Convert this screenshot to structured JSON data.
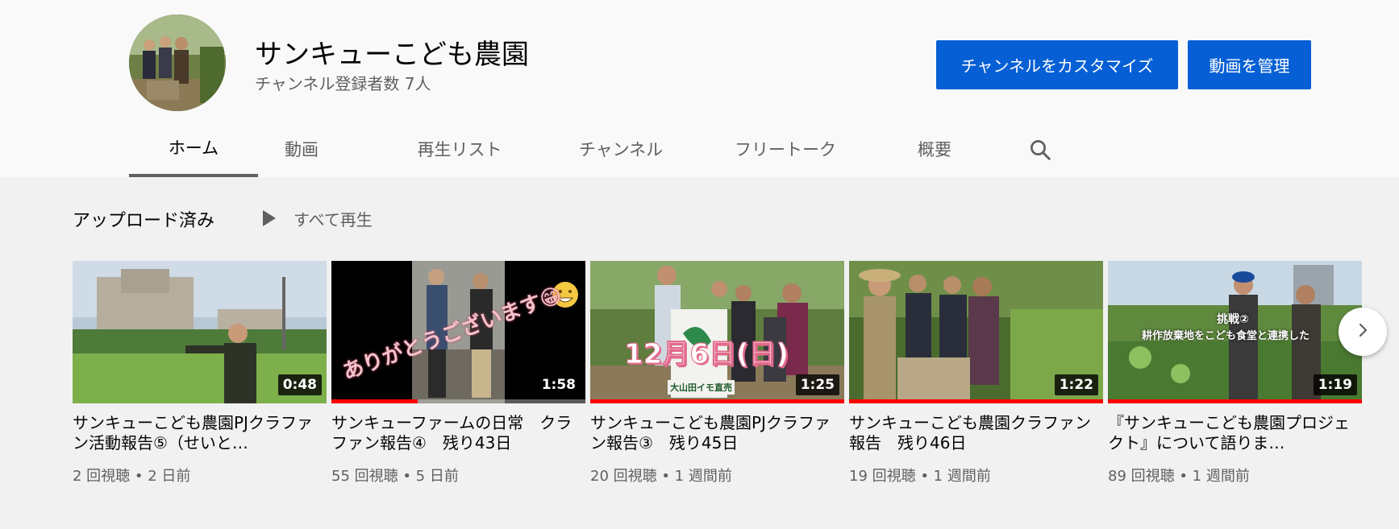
{
  "channel": {
    "name": "サンキューこども農園",
    "subscribers": "チャンネル登録者数 7人"
  },
  "buttons": {
    "customize": "チャンネルをカスタマイズ",
    "manage": "動画を管理"
  },
  "tabs": [
    {
      "label": "ホーム",
      "active": true
    },
    {
      "label": "動画",
      "active": false
    },
    {
      "label": "再生リスト",
      "active": false
    },
    {
      "label": "チャンネル",
      "active": false
    },
    {
      "label": "フリートーク",
      "active": false
    },
    {
      "label": "概要",
      "active": false
    }
  ],
  "icons": {
    "search": "search-icon",
    "play": "play-icon",
    "next": "chevron-right-icon"
  },
  "uploads": {
    "title": "アップロード済み",
    "play_all": "すべて再生"
  },
  "videos": [
    {
      "title": "サンキューこども農園PJクラファン活動報告⑤（せいと…",
      "meta": "2 回視聴 • 2 日前",
      "duration": "0:48",
      "progress": 0
    },
    {
      "title": "サンキューファームの日常　クラファン報告④　残り43日",
      "meta": "55 回視聴 • 5 日前",
      "duration": "1:58",
      "progress": 0.34,
      "overlay": "ありがとうございます😁"
    },
    {
      "title": "サンキューこども農園PJクラファン報告③　残り45日",
      "meta": "20 回視聴 • 1 週間前",
      "duration": "1:25",
      "progress": 1,
      "overlay": "12月6日(日)",
      "overlay_sub": "大山田イモ直売"
    },
    {
      "title": "サンキューこども農園クラファン報告　残り46日",
      "meta": "19 回視聴 • 1 週間前",
      "duration": "1:22",
      "progress": 1
    },
    {
      "title": "『サンキューこども農園プロジェクト』について語りま…",
      "meta": "89 回視聴 • 1 週間前",
      "duration": "1:19",
      "progress": 1,
      "overlay": "挑戦②",
      "overlay_sub": "耕作放棄地をこども食堂と連携した"
    }
  ],
  "colors": {
    "accent": "#065fd4",
    "progress": "#ff0000",
    "header_bg": "#f9f9f9",
    "page_bg": "#f1f1f1"
  }
}
